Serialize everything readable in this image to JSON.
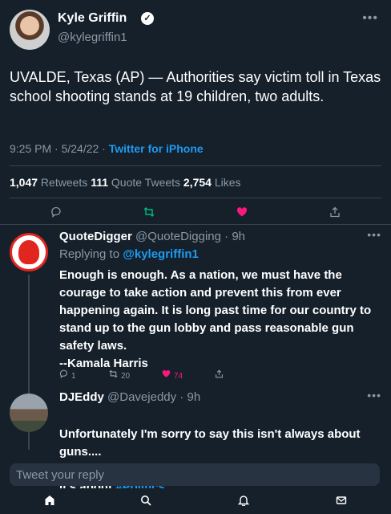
{
  "author": {
    "name": "Kyle Griffin",
    "handle": "@kylegriffin1",
    "verified_glyph": "✓"
  },
  "tweet": {
    "text": "UVALDE, Texas (AP) — Authorities say victim toll in Texas school shooting stands at 19 children, two adults.",
    "time": "9:25 PM · 5/24/22 · ",
    "source": "Twitter for iPhone",
    "retweets": "1,047",
    "retweets_label": " Retweets ",
    "quote_tweets": "111",
    "quote_tweets_label": " Quote Tweets ",
    "likes": "2,754",
    "likes_label": " Likes"
  },
  "actions": {
    "reply_icon": "comment-icon",
    "retweet_icon": "retweet-icon",
    "like_icon": "heart-icon",
    "share_icon": "share-icon"
  },
  "replies": [
    {
      "name": "QuoteDigger",
      "handle": "@QuoteDigging",
      "time": " · 9h",
      "replying_prefix": "Replying to ",
      "replying_to": "@kylegriffin1",
      "text": "Enough is enough. As a nation, we must have the courage to take action and prevent this from ever happening again. It is long past time for our country to stand up to the gun lobby and pass reasonable gun safety laws.\n--Kamala Harris",
      "reply_count": "1",
      "retweet_count": "20",
      "like_count": "74"
    },
    {
      "name": "DJEddy",
      "handle": "@Davejeddy",
      "time": " · 9h",
      "text_line1": "Unfortunately I'm sorry to say this isn't always about guns....",
      "text_line2": "It's about ",
      "hashtag": "#Politics"
    }
  ],
  "compose": {
    "placeholder": "Tweet your reply"
  },
  "colors": {
    "background": "#15202b",
    "accent": "#1d9bf0",
    "like": "#f91880",
    "retweet": "#00ba7c",
    "muted": "#8b98a5"
  },
  "nav": [
    "home-icon",
    "search-icon",
    "notifications-icon",
    "messages-icon"
  ]
}
